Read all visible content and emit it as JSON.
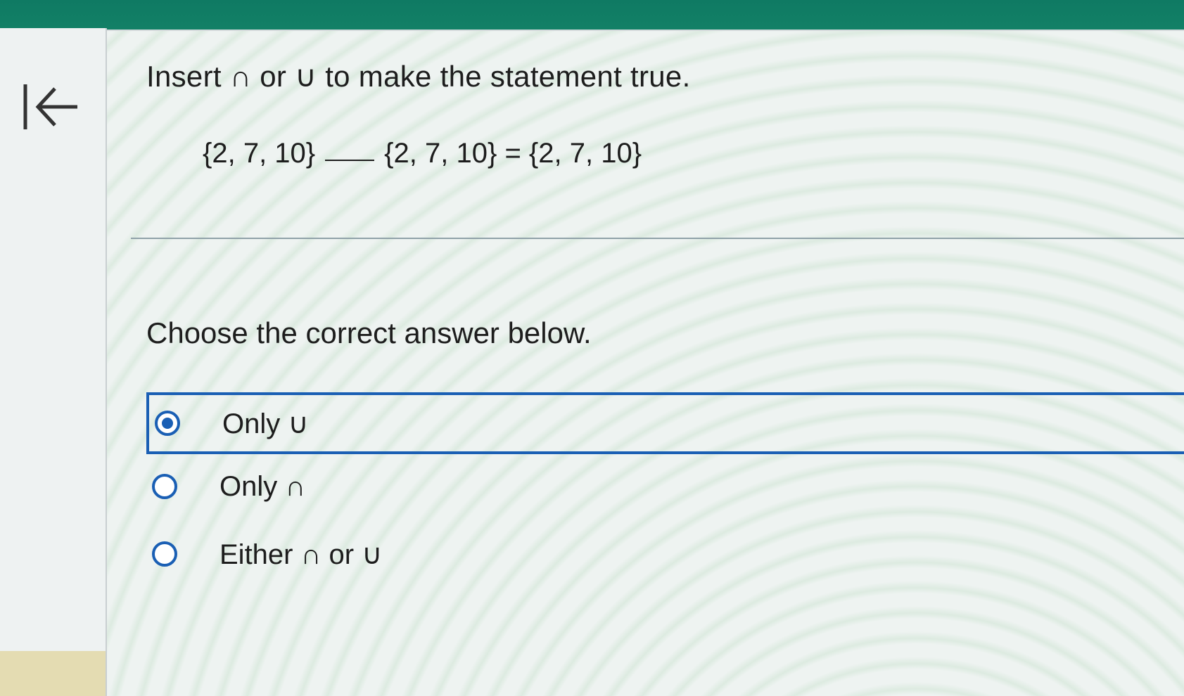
{
  "question": {
    "instruction": "Insert ∩ or ∪ to make the statement true.",
    "left_set": "{2, 7, 10}",
    "right_set": "{2, 7, 10}",
    "equals": "=",
    "result_set": "{2, 7, 10}"
  },
  "prompt": "Choose the correct answer below.",
  "options": [
    {
      "label": "Only ∪",
      "selected": true
    },
    {
      "label": "Only ∩",
      "selected": false
    },
    {
      "label": "Either ∩ or ∪",
      "selected": false
    }
  ],
  "colors": {
    "accent": "#1a5fb4",
    "header": "#128066"
  },
  "icons": {
    "back": "arrow-left-to-bar-icon"
  }
}
